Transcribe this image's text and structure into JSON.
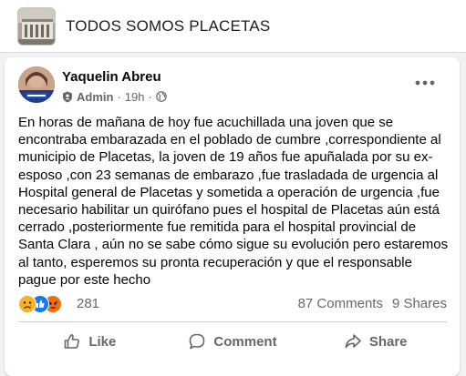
{
  "group": {
    "name": "TODOS SOMOS PLACETAS"
  },
  "post": {
    "author": "Yaquelin Abreu",
    "role": "Admin",
    "time": "19h",
    "text": "En horas de mañana de hoy fue acuchillada una joven que se\nencontraba embarazada en el poblado de cumbre ,correspondiente al\nmunicipio de Placetas,  la joven de 19 años fue apuñalada por su ex-\nesposo  ,con 23 semanas  de embarazo ,fue trasladada de urgencia al\nHospital general de Placetas y sometida a operación de urgencia ,fue\nnecesario habilitar un quirófano  pues el hospital de Placetas  aún está\ncerrado  ,posteriormente fue remitida  para el hospital provincial de\nSanta Clara , aún no se sabe cómo sigue su evolución pero estaremos\nal tanto, esperemos su pronta recuperación y que el responsable\npague por este hecho",
    "reactions_count": "281",
    "comments": "87 Comments",
    "shares": "9 Shares"
  },
  "actions": {
    "like": "Like",
    "comment": "Comment",
    "share": "Share"
  },
  "icons": {
    "reactions": [
      "sad-reaction-icon",
      "like-reaction-icon",
      "angry-reaction-icon"
    ],
    "audience": "globe-icon",
    "role_badge": "shield-icon"
  },
  "colors": {
    "like_blue": "#1877f2",
    "sad_yellow": "#f7b125",
    "angry_red": "#e9710f",
    "muted_text": "#65676b"
  }
}
